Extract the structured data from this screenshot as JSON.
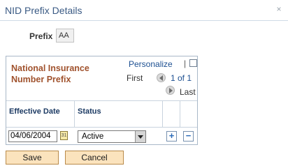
{
  "window": {
    "title": "NID Prefix Details",
    "close_glyph": "×"
  },
  "prefix": {
    "label": "Prefix",
    "value": "AA"
  },
  "grid": {
    "title": "National Insurance Number Prefix",
    "personalize_label": "Personalize",
    "separator": "|",
    "first_label": "First",
    "count_label": "1 of 1",
    "last_label": "Last",
    "columns": {
      "effective_date": "Effective Date",
      "status": "Status"
    },
    "rows": [
      {
        "effective_date": "04/06/2004",
        "status": "Active"
      }
    ],
    "calendar_glyph": "31",
    "add_glyph": "+",
    "delete_glyph": "−"
  },
  "buttons": {
    "save": "Save",
    "cancel": "Cancel"
  },
  "colors": {
    "title": "#3a5a84",
    "grid_title": "#a0522d",
    "link": "#1c4f91",
    "button_bg": "#fbe3bd"
  }
}
